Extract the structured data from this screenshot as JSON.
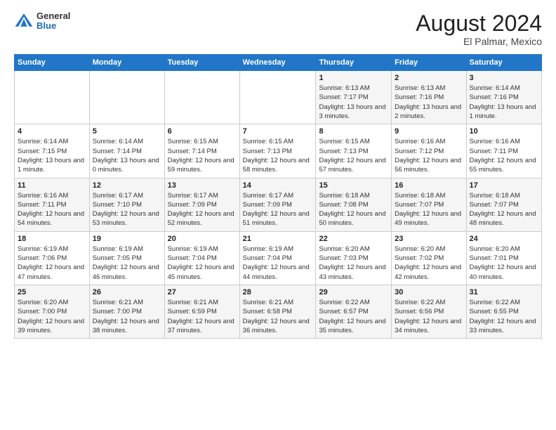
{
  "header": {
    "logo_general": "General",
    "logo_blue": "Blue",
    "month_year": "August 2024",
    "location": "El Palmar, Mexico"
  },
  "weekdays": [
    "Sunday",
    "Monday",
    "Tuesday",
    "Wednesday",
    "Thursday",
    "Friday",
    "Saturday"
  ],
  "weeks": [
    [
      {
        "day": "",
        "info": ""
      },
      {
        "day": "",
        "info": ""
      },
      {
        "day": "",
        "info": ""
      },
      {
        "day": "",
        "info": ""
      },
      {
        "day": "1",
        "sunrise": "Sunrise: 6:13 AM",
        "sunset": "Sunset: 7:17 PM",
        "daylight": "Daylight: 13 hours and 3 minutes."
      },
      {
        "day": "2",
        "sunrise": "Sunrise: 6:13 AM",
        "sunset": "Sunset: 7:16 PM",
        "daylight": "Daylight: 13 hours and 2 minutes."
      },
      {
        "day": "3",
        "sunrise": "Sunrise: 6:14 AM",
        "sunset": "Sunset: 7:16 PM",
        "daylight": "Daylight: 13 hours and 1 minute."
      }
    ],
    [
      {
        "day": "4",
        "sunrise": "Sunrise: 6:14 AM",
        "sunset": "Sunset: 7:15 PM",
        "daylight": "Daylight: 13 hours and 1 minute."
      },
      {
        "day": "5",
        "sunrise": "Sunrise: 6:14 AM",
        "sunset": "Sunset: 7:14 PM",
        "daylight": "Daylight: 13 hours and 0 minutes."
      },
      {
        "day": "6",
        "sunrise": "Sunrise: 6:15 AM",
        "sunset": "Sunset: 7:14 PM",
        "daylight": "Daylight: 12 hours and 59 minutes."
      },
      {
        "day": "7",
        "sunrise": "Sunrise: 6:15 AM",
        "sunset": "Sunset: 7:13 PM",
        "daylight": "Daylight: 12 hours and 58 minutes."
      },
      {
        "day": "8",
        "sunrise": "Sunrise: 6:15 AM",
        "sunset": "Sunset: 7:13 PM",
        "daylight": "Daylight: 12 hours and 57 minutes."
      },
      {
        "day": "9",
        "sunrise": "Sunrise: 6:16 AM",
        "sunset": "Sunset: 7:12 PM",
        "daylight": "Daylight: 12 hours and 56 minutes."
      },
      {
        "day": "10",
        "sunrise": "Sunrise: 6:16 AM",
        "sunset": "Sunset: 7:11 PM",
        "daylight": "Daylight: 12 hours and 55 minutes."
      }
    ],
    [
      {
        "day": "11",
        "sunrise": "Sunrise: 6:16 AM",
        "sunset": "Sunset: 7:11 PM",
        "daylight": "Daylight: 12 hours and 54 minutes."
      },
      {
        "day": "12",
        "sunrise": "Sunrise: 6:17 AM",
        "sunset": "Sunset: 7:10 PM",
        "daylight": "Daylight: 12 hours and 53 minutes."
      },
      {
        "day": "13",
        "sunrise": "Sunrise: 6:17 AM",
        "sunset": "Sunset: 7:09 PM",
        "daylight": "Daylight: 12 hours and 52 minutes."
      },
      {
        "day": "14",
        "sunrise": "Sunrise: 6:17 AM",
        "sunset": "Sunset: 7:09 PM",
        "daylight": "Daylight: 12 hours and 51 minutes."
      },
      {
        "day": "15",
        "sunrise": "Sunrise: 6:18 AM",
        "sunset": "Sunset: 7:08 PM",
        "daylight": "Daylight: 12 hours and 50 minutes."
      },
      {
        "day": "16",
        "sunrise": "Sunrise: 6:18 AM",
        "sunset": "Sunset: 7:07 PM",
        "daylight": "Daylight: 12 hours and 49 minutes."
      },
      {
        "day": "17",
        "sunrise": "Sunrise: 6:18 AM",
        "sunset": "Sunset: 7:07 PM",
        "daylight": "Daylight: 12 hours and 48 minutes."
      }
    ],
    [
      {
        "day": "18",
        "sunrise": "Sunrise: 6:19 AM",
        "sunset": "Sunset: 7:06 PM",
        "daylight": "Daylight: 12 hours and 47 minutes."
      },
      {
        "day": "19",
        "sunrise": "Sunrise: 6:19 AM",
        "sunset": "Sunset: 7:05 PM",
        "daylight": "Daylight: 12 hours and 46 minutes."
      },
      {
        "day": "20",
        "sunrise": "Sunrise: 6:19 AM",
        "sunset": "Sunset: 7:04 PM",
        "daylight": "Daylight: 12 hours and 45 minutes."
      },
      {
        "day": "21",
        "sunrise": "Sunrise: 6:19 AM",
        "sunset": "Sunset: 7:04 PM",
        "daylight": "Daylight: 12 hours and 44 minutes."
      },
      {
        "day": "22",
        "sunrise": "Sunrise: 6:20 AM",
        "sunset": "Sunset: 7:03 PM",
        "daylight": "Daylight: 12 hours and 43 minutes."
      },
      {
        "day": "23",
        "sunrise": "Sunrise: 6:20 AM",
        "sunset": "Sunset: 7:02 PM",
        "daylight": "Daylight: 12 hours and 42 minutes."
      },
      {
        "day": "24",
        "sunrise": "Sunrise: 6:20 AM",
        "sunset": "Sunset: 7:01 PM",
        "daylight": "Daylight: 12 hours and 40 minutes."
      }
    ],
    [
      {
        "day": "25",
        "sunrise": "Sunrise: 6:20 AM",
        "sunset": "Sunset: 7:00 PM",
        "daylight": "Daylight: 12 hours and 39 minutes."
      },
      {
        "day": "26",
        "sunrise": "Sunrise: 6:21 AM",
        "sunset": "Sunset: 7:00 PM",
        "daylight": "Daylight: 12 hours and 38 minutes."
      },
      {
        "day": "27",
        "sunrise": "Sunrise: 6:21 AM",
        "sunset": "Sunset: 6:59 PM",
        "daylight": "Daylight: 12 hours and 37 minutes."
      },
      {
        "day": "28",
        "sunrise": "Sunrise: 6:21 AM",
        "sunset": "Sunset: 6:58 PM",
        "daylight": "Daylight: 12 hours and 36 minutes."
      },
      {
        "day": "29",
        "sunrise": "Sunrise: 6:22 AM",
        "sunset": "Sunset: 6:57 PM",
        "daylight": "Daylight: 12 hours and 35 minutes."
      },
      {
        "day": "30",
        "sunrise": "Sunrise: 6:22 AM",
        "sunset": "Sunset: 6:56 PM",
        "daylight": "Daylight: 12 hours and 34 minutes."
      },
      {
        "day": "31",
        "sunrise": "Sunrise: 6:22 AM",
        "sunset": "Sunset: 6:55 PM",
        "daylight": "Daylight: 12 hours and 33 minutes."
      }
    ]
  ]
}
